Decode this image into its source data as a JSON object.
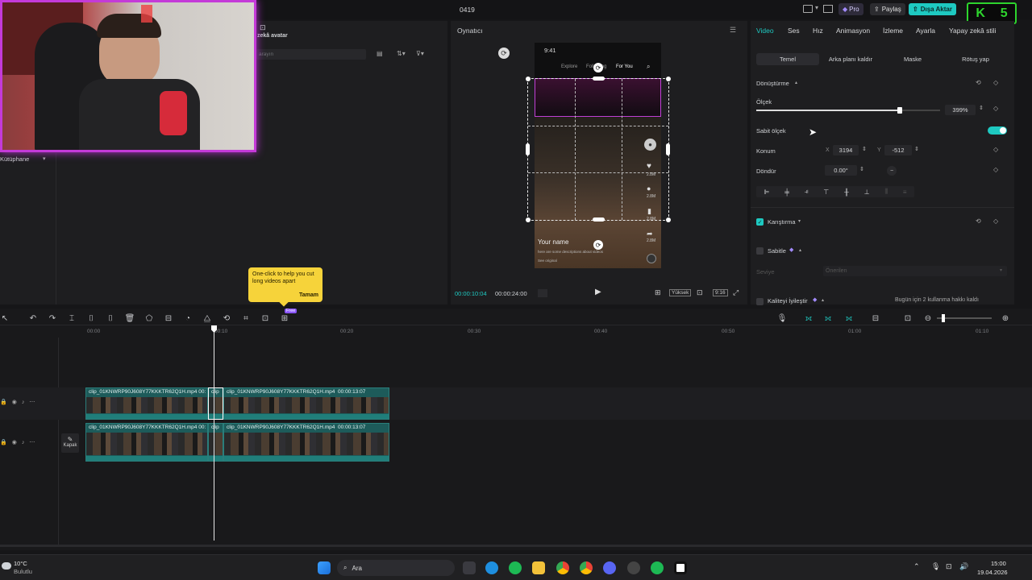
{
  "topbar": {
    "project_name": "0419",
    "pro_label": "Pro",
    "share_label": "Paylaş",
    "export_label": "Dışa Aktar",
    "overlay_badge": "5"
  },
  "left_panel": {
    "avatar_label": "zekâ avatar",
    "search_placeholder": "arayın",
    "library_label": "Kütüphane"
  },
  "player": {
    "title": "Oynatıcı",
    "current_time": "00:00:10:04",
    "total_time": "00:00:24:00",
    "quality_label": "Yüksek",
    "ratio_label": "9:16",
    "phone": {
      "time": "9:41",
      "tabs": [
        "Explore",
        "Following",
        "For You"
      ],
      "likes": "2.8M",
      "comments": "2.8M",
      "saves": "2.8M",
      "shares": "2.8M",
      "user_name": "Your name",
      "description": "here are some descriptions about videos",
      "sound": "See original"
    }
  },
  "right_panel": {
    "tabs": [
      "Video",
      "Ses",
      "Hız",
      "Animasyon",
      "İzleme",
      "Ayarla",
      "Yapay zekâ stili"
    ],
    "active_tab": "Video",
    "subtabs": [
      "Temel",
      "Arka planı kaldır",
      "Maske",
      "Rötuş yap"
    ],
    "transform_header": "Dönüştürme",
    "scale_label": "Ölçek",
    "scale_value": "399%",
    "scale_fraction": 0.78,
    "uniform_scale_label": "Sabit ölçek",
    "position_label": "Konum",
    "x_label": "X",
    "x_value": "3194",
    "y_label": "Y",
    "y_value": "-512",
    "rotate_label": "Döndür",
    "rotate_value": "0.00°",
    "blend_label": "Karıştırma",
    "stabilize_label": "Sabitle",
    "level_label": "Seviye",
    "level_value": "Önerilen",
    "enhance_label": "Kaliteyi İyileştir",
    "enhance_note": "Bugün için 2 kullanma hakkı kaldı"
  },
  "tooltip": {
    "text": "One-click to help you cut long videos apart",
    "button": "Tamam"
  },
  "toolbar": {
    "free_badge": "Free"
  },
  "timeline": {
    "ruler": [
      "00:00",
      "00:10",
      "00:20",
      "00:30",
      "00:40",
      "00:50",
      "01:00",
      "01:10"
    ],
    "cover_label": "Kapak",
    "clips": [
      {
        "name": "clip_01KNWRP90J608Y77KKKTR62Q1H.mp4",
        "duration": "00:"
      },
      {
        "name": "clip",
        "duration": ""
      },
      {
        "name": "clip_01KNWRP90J608Y77KKKTR62Q1H.mp4",
        "duration": "00:00:13:07"
      },
      {
        "name": "clip_01KNWRP90J608Y77KKKTR62Q1H.mp4",
        "duration": "00:"
      },
      {
        "name": "clip",
        "duration": ""
      },
      {
        "name": "clip_01KNWRP90J608Y77KKKTR62Q1H.mp4",
        "duration": "00:00:13:07"
      }
    ]
  },
  "taskbar": {
    "temperature": "10°C",
    "weather": "Bulutlu",
    "search_label": "Ara",
    "time": "15:00",
    "date": "19.04.2026"
  },
  "colors": {
    "accent": "#1ec9c1",
    "clip": "#1d5b5a",
    "tooltip": "#f6d33a",
    "webcam_border": "#c43ad8"
  }
}
